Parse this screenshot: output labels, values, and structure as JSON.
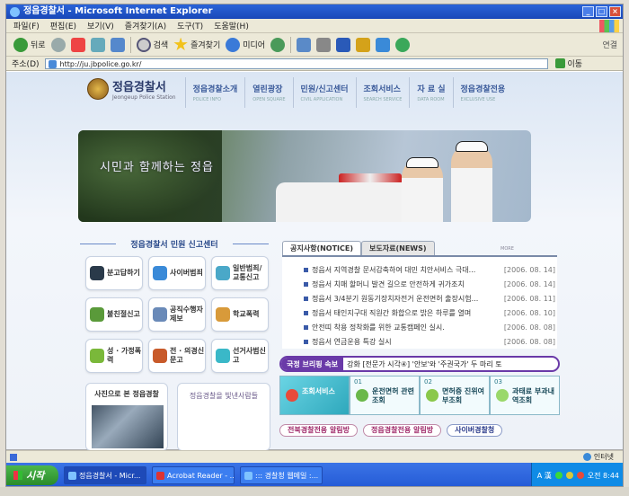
{
  "window": {
    "title": "정읍경찰서 - Microsoft Internet Explorer"
  },
  "menu": [
    "파일(F)",
    "편집(E)",
    "보기(V)",
    "즐겨찾기(A)",
    "도구(T)",
    "도움말(H)"
  ],
  "toolbar": {
    "back": "뒤로",
    "search": "검색",
    "favorites": "즐겨찾기",
    "media": "미디어",
    "links": "연결"
  },
  "address": {
    "label": "주소(D)",
    "url": "http://ju.jbpolice.go.kr/",
    "go": "이동"
  },
  "site": {
    "logo": {
      "name": "정읍경찰서",
      "sub": "Jeongeup Police Station"
    },
    "nav": [
      {
        "label": "정읍경찰소개",
        "sub": "POLICE INFO"
      },
      {
        "label": "열린광장",
        "sub": "OPEN SQUARE"
      },
      {
        "label": "민원/신고센터",
        "sub": "CIVIL APPLICATION"
      },
      {
        "label": "조회서비스",
        "sub": "SEARCH SERVICE"
      },
      {
        "label": "자 료 실",
        "sub": "DATA ROOM"
      },
      {
        "label": "정읍경찰전용",
        "sub": "EXCLUSIVE USE"
      }
    ],
    "slogan": "시민과 함께하는 정읍",
    "civil_title": "정읍경찰서 민원 신고센터",
    "services": [
      "분고답하기",
      "사이버범죄",
      "일반범죄/교통신고",
      "불친절신고",
      "공직수행자제보",
      "학교폭력",
      "성 · 가정폭력",
      "전 · 의경신문고",
      "선거사범신고"
    ],
    "photo_title": "사진으로 본 정읍경찰",
    "people_title": "정읍경찰을 빛낸사람들",
    "tabs": [
      "공지사항(NOTICE)",
      "보도자료(NEWS)"
    ],
    "more": "MORE",
    "notices": [
      {
        "text": "정읍서 지역경찰 문서감축하여 대민 치안서비스 극대...",
        "date": "[2006. 08. 14]"
      },
      {
        "text": "정읍서 치매 할머니 발견 길으로 안전하게 귀가조치",
        "date": "[2006. 08. 14]"
      },
      {
        "text": "정읍서 3/4분기 원동기장치자전거 운전면허 출장시험...",
        "date": "[2006. 08. 11]"
      },
      {
        "text": "정읍서 태인지구대 직원간 화합으로 밝은 하루를 열며",
        "date": "[2006. 08. 10]"
      },
      {
        "text": "안전띠 착용 정착화를 위한 교통캠페인 실시.",
        "date": "[2006. 08. 08]"
      },
      {
        "text": "정읍서 연금운용 특강 실시",
        "date": "[2006. 08. 08]"
      }
    ],
    "breaking": {
      "label": "국정 브리핑 속보",
      "text": "강화 [전문가 시각④] '안보'와 '주권국가' 두 마리 토"
    },
    "quick": [
      {
        "n": "",
        "label": "조회서비스"
      },
      {
        "n": "01",
        "label": "운전면허 관련조회"
      },
      {
        "n": "02",
        "label": "면허증 진위여부조회"
      },
      {
        "n": "03",
        "label": "과태료 부과내역조회"
      }
    ],
    "bottom_links": [
      "전북경찰전용 알림방",
      "정읍경찰전용 알림방",
      "사이버경찰청"
    ]
  },
  "status": {
    "zone": "인터넷"
  },
  "taskbar": {
    "start": "시작",
    "tasks": [
      "정읍경찰서 - Micr...",
      "Acrobat Reader - ...",
      "::: 경찰청 웹메일 :..."
    ],
    "tray": "A 漢",
    "clock": "오전 8:44"
  }
}
